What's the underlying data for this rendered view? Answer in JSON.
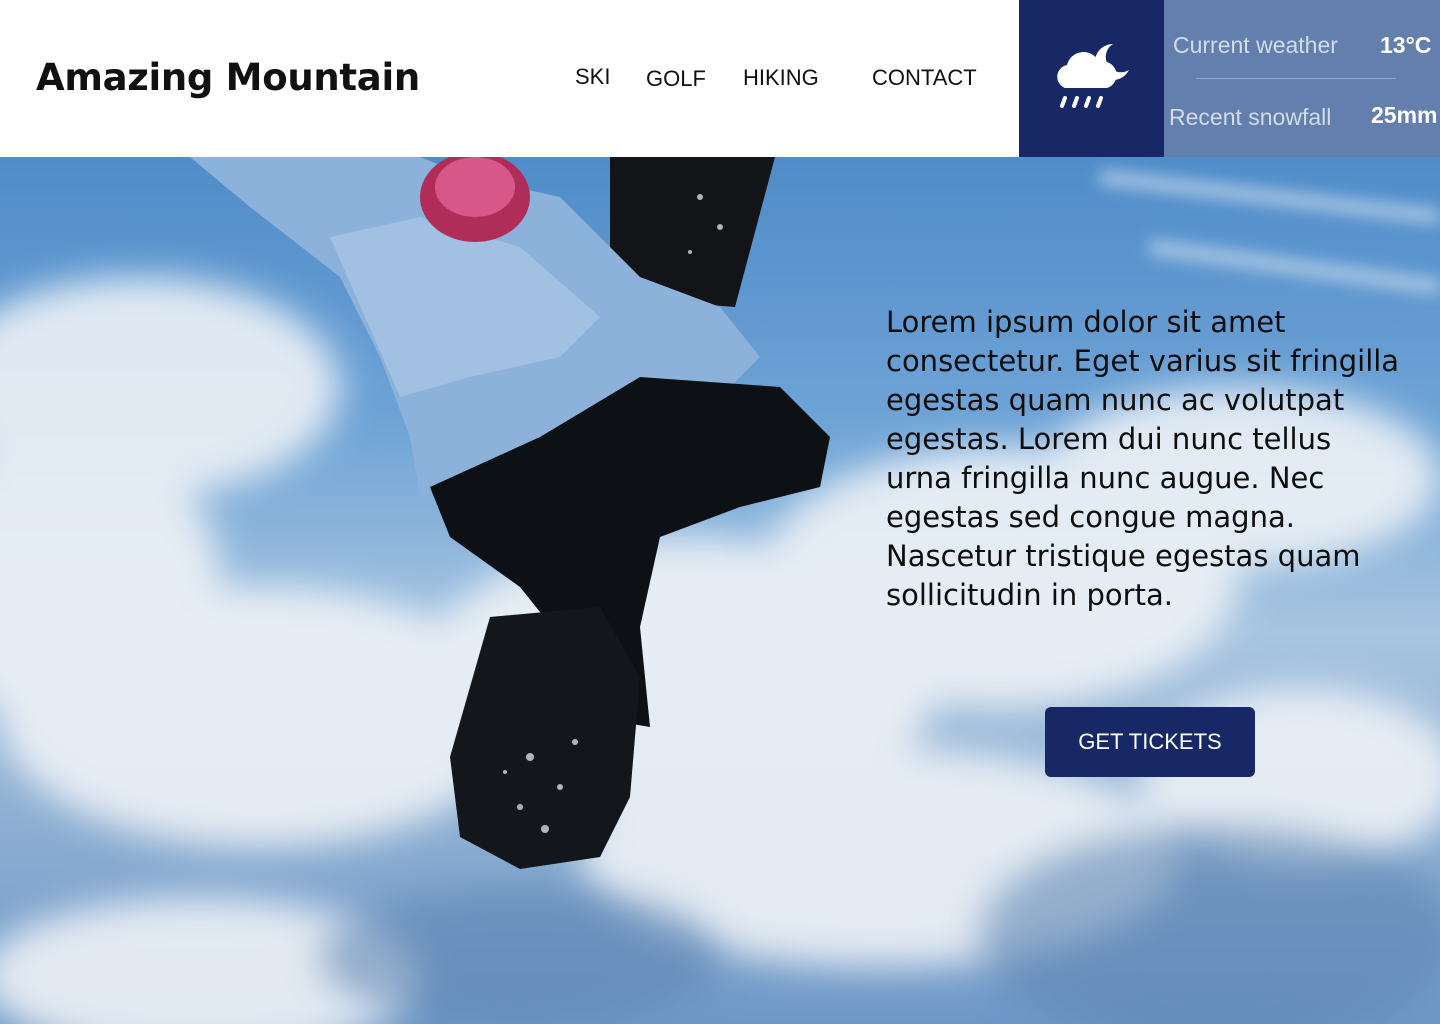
{
  "header": {
    "brand": "Amazing Mountain",
    "nav": [
      {
        "label": "SKI"
      },
      {
        "label": "GOLF"
      },
      {
        "label": "HIKING"
      },
      {
        "label": "CONTACT"
      }
    ]
  },
  "weather": {
    "icon": "cloud-rain-moon-icon",
    "current_label": "Current weather",
    "current_value": "13°C",
    "snow_label": "Recent snowfall",
    "snow_value": "25mm"
  },
  "hero": {
    "image": "snowboarder-jump-photo",
    "body": "Lorem ipsum dolor sit amet consectetur. Eget varius sit fringilla egestas quam nunc ac volutpat egestas. Lorem dui nunc tellus urna fringilla nunc augue. Nec egestas sed congue magna. Nascetur tristique egestas quam sollicitudin in porta.",
    "cta": "GET TICKETS"
  },
  "colors": {
    "navy": "#182866",
    "weather_panel": "#637fae",
    "sky": "#5a8fc8"
  }
}
